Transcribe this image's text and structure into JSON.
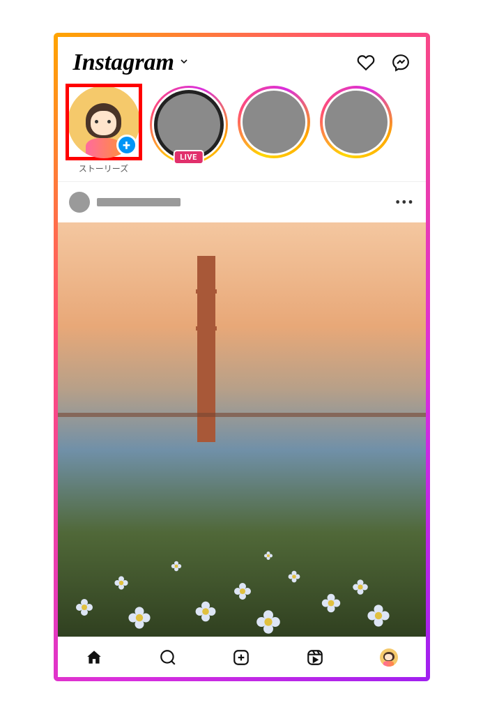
{
  "header": {
    "logo_text": "Instagram"
  },
  "stories": {
    "my_story_label": "ストーリーズ",
    "live_badge": "LIVE"
  }
}
